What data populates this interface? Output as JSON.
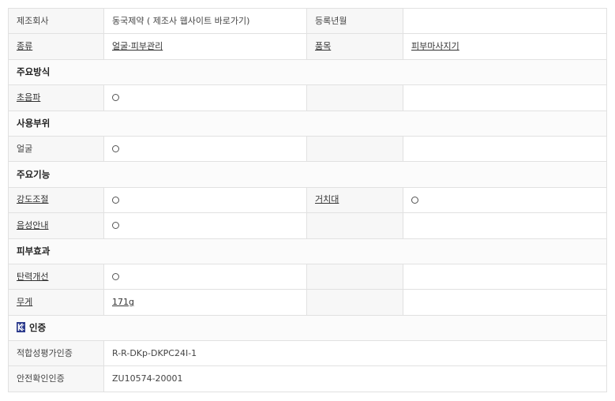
{
  "basic": {
    "maker_label": "제조회사",
    "maker_value": "동국제약 ( 제조사 웹사이트 바로가기)",
    "reg_label": "등록년월",
    "reg_value": "",
    "category_label": "종류",
    "category_value": "얼굴·피부관리",
    "item_label": "품목",
    "item_value": "피부마사지기"
  },
  "sections": {
    "method": "주요방식",
    "part": "사용부위",
    "function": "주요기능",
    "effect": "피부효과",
    "cert": "인증"
  },
  "rows": {
    "ultrasonic": "초음파",
    "face": "얼굴",
    "intensity": "강도조절",
    "stand": "거치대",
    "voice": "음성안내",
    "elasticity": "탄력개선",
    "weight_label": "무게",
    "weight_value": "171g",
    "kc_label": "적합성평가인증",
    "kc_value": "R-R-DKp-DKPC24I-1",
    "safety_label": "안전확인인증",
    "safety_value": "ZU10574-20001"
  },
  "icons": {
    "check": "circle-icon",
    "kc_mark": "kc-mark-icon"
  },
  "colors": {
    "kc_mark": "#2b3a8c",
    "border": "#e1e1e1"
  }
}
